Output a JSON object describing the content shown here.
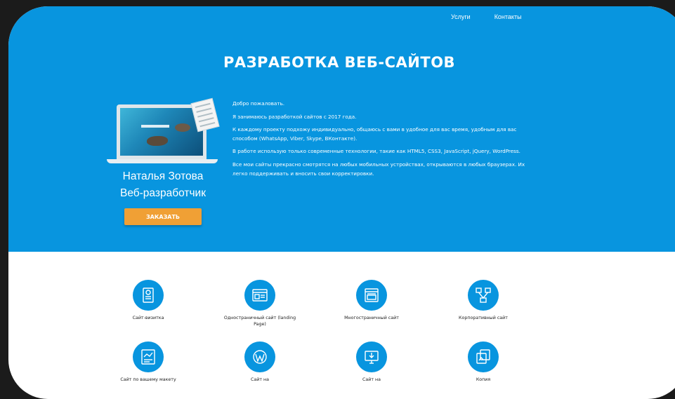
{
  "nav": {
    "services": "Услуги",
    "contacts": "Контакты"
  },
  "hero": {
    "title": "РАЗРАБОТКА ВЕБ-САЙТОВ",
    "name": "Наталья Зотова",
    "role": "Веб-разработчик",
    "order_button": "ЗАКАЗАТЬ",
    "paragraphs": [
      "Добро пожаловать.",
      "Я занимаюсь разработкой сайтов с 2017 года.",
      "К каждому проекту подхожу индивидуально, общаюсь с вами в удобное для вас время, удобным для вас способом (WhatsApp, Viber, Skype, ВКонтакте).",
      "В работе использую только современные технологии, такие как HTML5, CSS3, JavaScript, jQuery, WordPress.",
      "Все мои сайты прекрасно смотрятся на любых мобильных устройствах, открываются в любых браузерах. Их легко поддерживать и вносить свои корректировки."
    ]
  },
  "services": [
    {
      "label": "Сайт-визитка",
      "icon": "business-card-icon"
    },
    {
      "label": "Одностраничный сайт (landing Page)",
      "icon": "landing-page-icon"
    },
    {
      "label": "Многостраничный сайт",
      "icon": "multipage-site-icon"
    },
    {
      "label": "Корпоративный сайт",
      "icon": "corporate-network-icon"
    },
    {
      "label": "Сайт по вашему макету",
      "icon": "layout-mockup-icon"
    },
    {
      "label": "Сайт на",
      "icon": "wordpress-icon"
    },
    {
      "label": "Сайт на",
      "icon": "cms-download-icon"
    },
    {
      "label": "Копия",
      "icon": "copy-site-icon"
    }
  ],
  "colors": {
    "accent": "#0895df",
    "button": "#f0a035",
    "background": "#1b1b1b"
  }
}
